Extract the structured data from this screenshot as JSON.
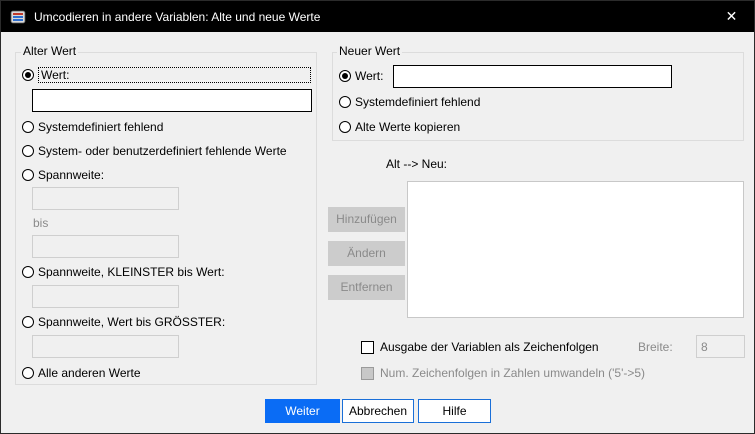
{
  "window": {
    "title": "Umcodieren in andere Variablen: Alte und neue Werte",
    "close_glyph": "✕",
    "icon": "spss-dataset-icon"
  },
  "old_value": {
    "legend": "Alter Wert",
    "value_label": "Wert:",
    "value_input": "",
    "system_missing": "Systemdefiniert fehlend",
    "system_or_user_missing": "System- oder benutzerdefiniert fehlende Werte",
    "range_label": "Spannweite:",
    "range_from": "",
    "range_to_label": "bis",
    "range_to": "",
    "range_lowest_label": "Spannweite, KLEINSTER bis Wert:",
    "range_lowest_value": "",
    "range_highest_label": "Spannweite, Wert bis GRÖSSTER:",
    "range_highest_value": "",
    "all_other_label": "Alle anderen Werte",
    "selected": "Wert:"
  },
  "new_value": {
    "legend": "Neuer Wert",
    "value_label": "Wert:",
    "value_input": "",
    "system_missing": "Systemdefiniert fehlend",
    "copy_old": "Alte Werte kopieren",
    "selected": "Wert:"
  },
  "mapping": {
    "label": "Alt --> Neu:",
    "add_button": "Hinzufügen",
    "change_button": "Ändern",
    "remove_button": "Entfernen",
    "items": []
  },
  "options": {
    "output_as_strings": "Ausgabe der Variablen als Zeichenfolgen",
    "width_label": "Breite:",
    "width_value": "8",
    "convert_numeric": "Num. Zeichenfolgen in Zahlen umwandeln ('5'->5)"
  },
  "footer": {
    "continue": "Weiter",
    "cancel": "Abbrechen",
    "help": "Hilfe"
  },
  "colors": {
    "titlebar": "#000000",
    "primary_button": "#0a6cf5",
    "disabled_button": "#cccccc"
  }
}
